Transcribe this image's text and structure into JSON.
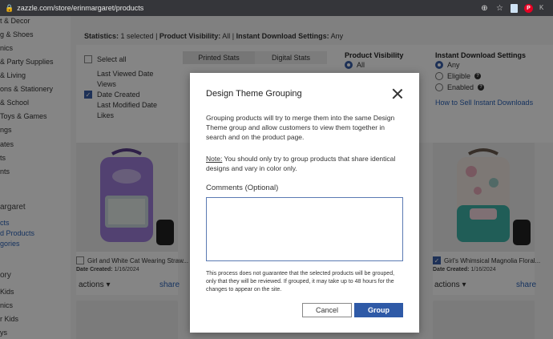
{
  "browser": {
    "url": "zazzle.com/store/erinmargaret/products",
    "pinterest_letter": "P",
    "profile_letter": "K"
  },
  "sidebar": {
    "items": [
      {
        "label": "t & Decor",
        "type": "text"
      },
      {
        "label": "g & Shoes",
        "type": "text"
      },
      {
        "label": "nics",
        "type": "text"
      },
      {
        "label": "& Party Supplies",
        "type": "text"
      },
      {
        "label": "& Living",
        "type": "text"
      },
      {
        "label": "ons & Stationery",
        "type": "text"
      },
      {
        "label": "& School",
        "type": "text"
      },
      {
        "label": "Toys & Games",
        "type": "text"
      },
      {
        "label": "ngs",
        "type": "text"
      },
      {
        "label": "ates",
        "type": "text"
      },
      {
        "label": "ts",
        "type": "text"
      },
      {
        "label": "nts",
        "type": "text"
      },
      {
        "label": "argaret",
        "type": "head"
      },
      {
        "label": "cts",
        "type": "link"
      },
      {
        "label": "d Products",
        "type": "link"
      },
      {
        "label": "gories",
        "type": "link"
      },
      {
        "label": "ory",
        "type": "head"
      },
      {
        "label": "Kids",
        "type": "text"
      },
      {
        "label": "nics",
        "type": "text"
      },
      {
        "label": "r Kids",
        "type": "text"
      },
      {
        "label": "ys",
        "type": "text"
      }
    ]
  },
  "statistics": {
    "prefix": "Statistics:",
    "selected": "1 selected",
    "visibility_label": "Product Visibility:",
    "visibility_value": "All",
    "download_label": "Instant Download Settings:",
    "download_value": "Any"
  },
  "filters": {
    "select_all": "Select all",
    "sort_options": [
      {
        "label": "Last Viewed Date",
        "checked": false
      },
      {
        "label": "Views",
        "checked": false
      },
      {
        "label": "Date Created",
        "checked": true
      },
      {
        "label": "Last Modified Date",
        "checked": false
      },
      {
        "label": "Likes",
        "checked": false
      }
    ],
    "stat_tabs": [
      {
        "label": "Printed Stats",
        "active": true
      },
      {
        "label": "Digital Stats",
        "active": false
      }
    ],
    "product_visibility": {
      "title": "Product Visibility",
      "options": [
        {
          "label": "All",
          "selected": true
        }
      ]
    },
    "instant_download": {
      "title": "Instant Download Settings",
      "options": [
        {
          "label": "Any",
          "selected": true,
          "help": false
        },
        {
          "label": "Eligible",
          "selected": false,
          "help": true
        },
        {
          "label": "Enabled",
          "selected": false,
          "help": true
        }
      ],
      "help_link": "How to Sell Instant Downloads"
    }
  },
  "products": [
    {
      "name": "Girl and White Cat Wearing Straw...",
      "date_label": "Date Created:",
      "date": "1/16/2024",
      "checked": false,
      "color": "#9d7ed8"
    },
    {
      "name": "Girl's Whimsical Magnolia Floral...",
      "date_label": "Date Created:",
      "date": "1/16/2024",
      "checked": true,
      "color": "#3fb3a8"
    }
  ],
  "card_actions": {
    "actions": "actions",
    "share": "share"
  },
  "modal": {
    "title": "Design Theme Grouping",
    "description": "Grouping products will try to merge them into the same Design Theme group and allow customers to view them together in search and on the product page.",
    "note_label": "Note:",
    "note_text": " You should only try to group products that share identical designs and vary in color only.",
    "comments_label": "Comments (Optional)",
    "comments_value": "",
    "disclaimer": "This process does not guarantee that the selected products will be grouped, only that they will be reviewed. If grouped, it may take up to 48 hours for the changes to appear on the site.",
    "cancel_label": "Cancel",
    "group_label": "Group"
  },
  "colors": {
    "accent": "#2f5aa7",
    "link": "#2b62b7",
    "overlay": "rgba(0,0,0,0.48)"
  }
}
